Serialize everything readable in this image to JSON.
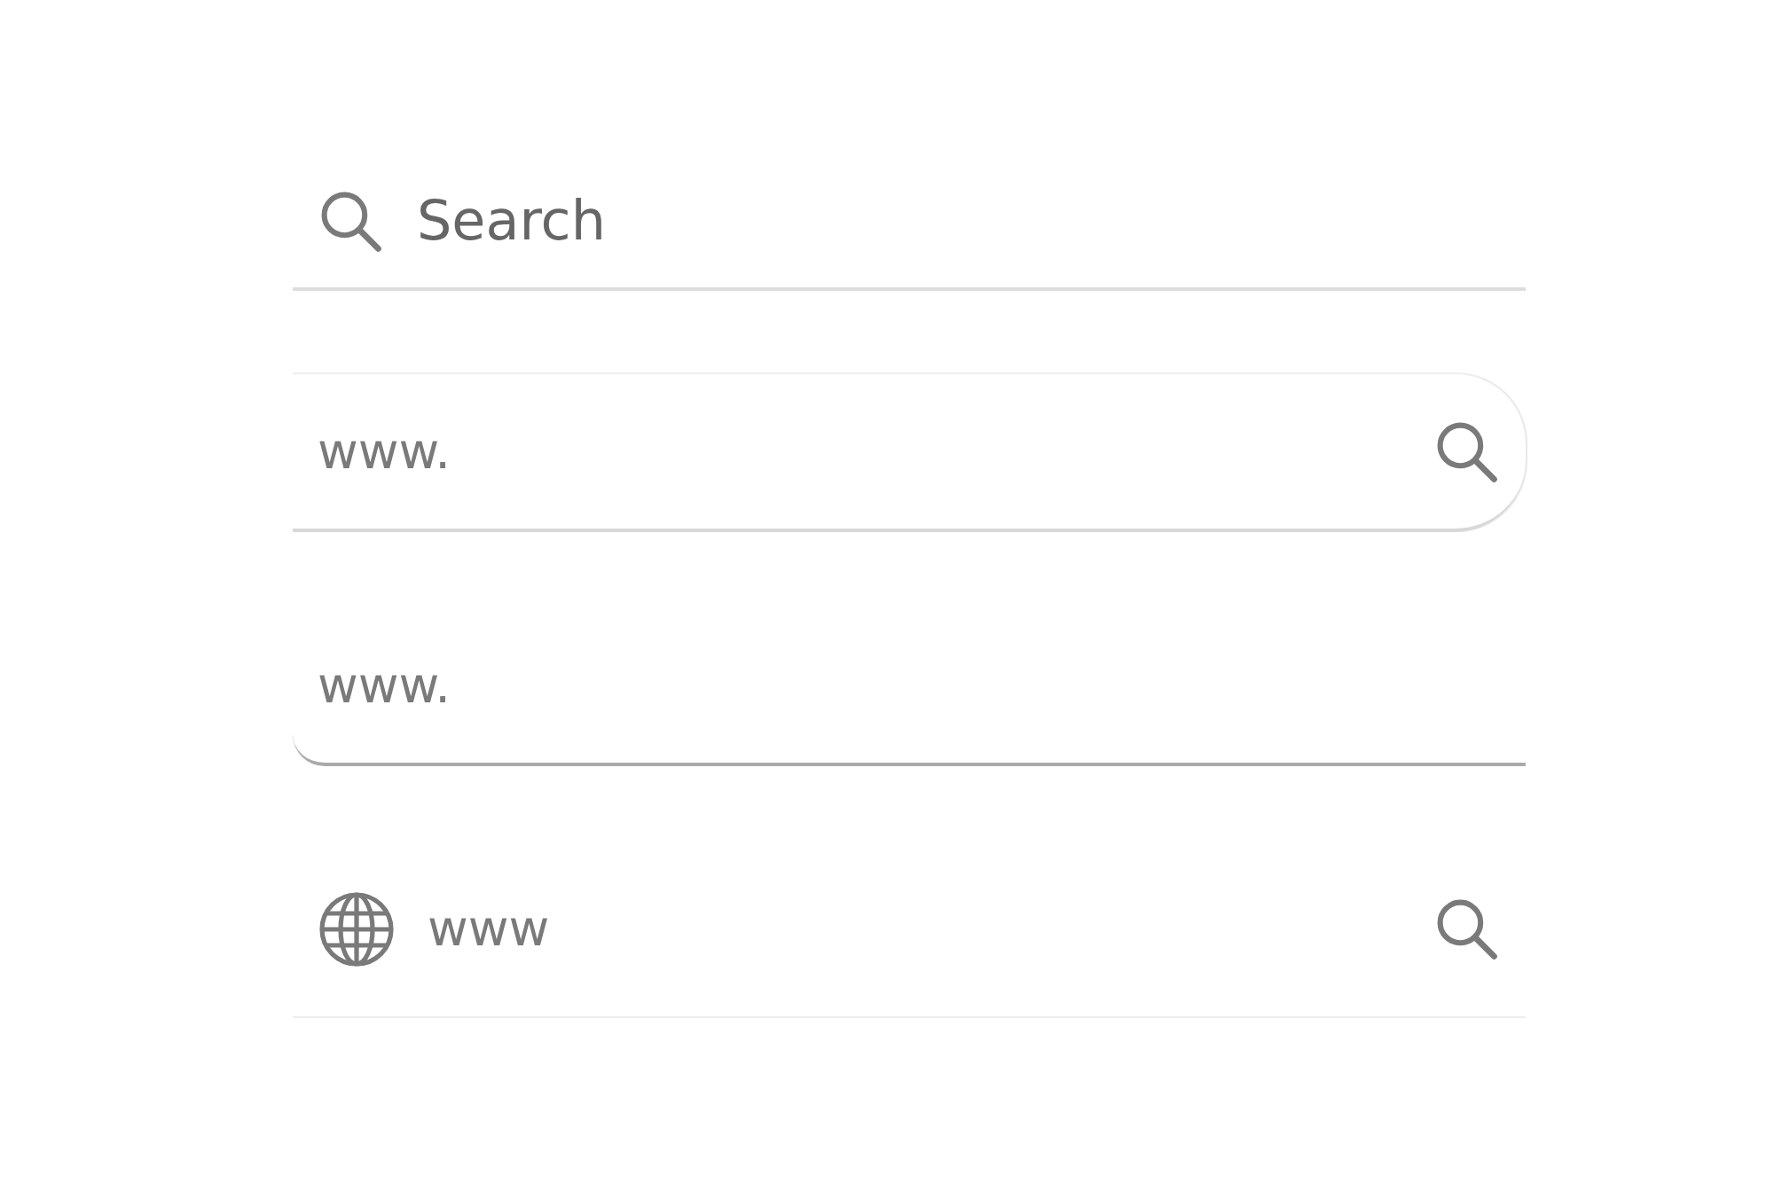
{
  "search_bars": [
    {
      "kind": "search-left",
      "placeholder": "Search"
    },
    {
      "kind": "search-right",
      "placeholder": "www."
    },
    {
      "kind": "plain",
      "placeholder": "www."
    },
    {
      "kind": "globe",
      "placeholder": "www"
    }
  ]
}
